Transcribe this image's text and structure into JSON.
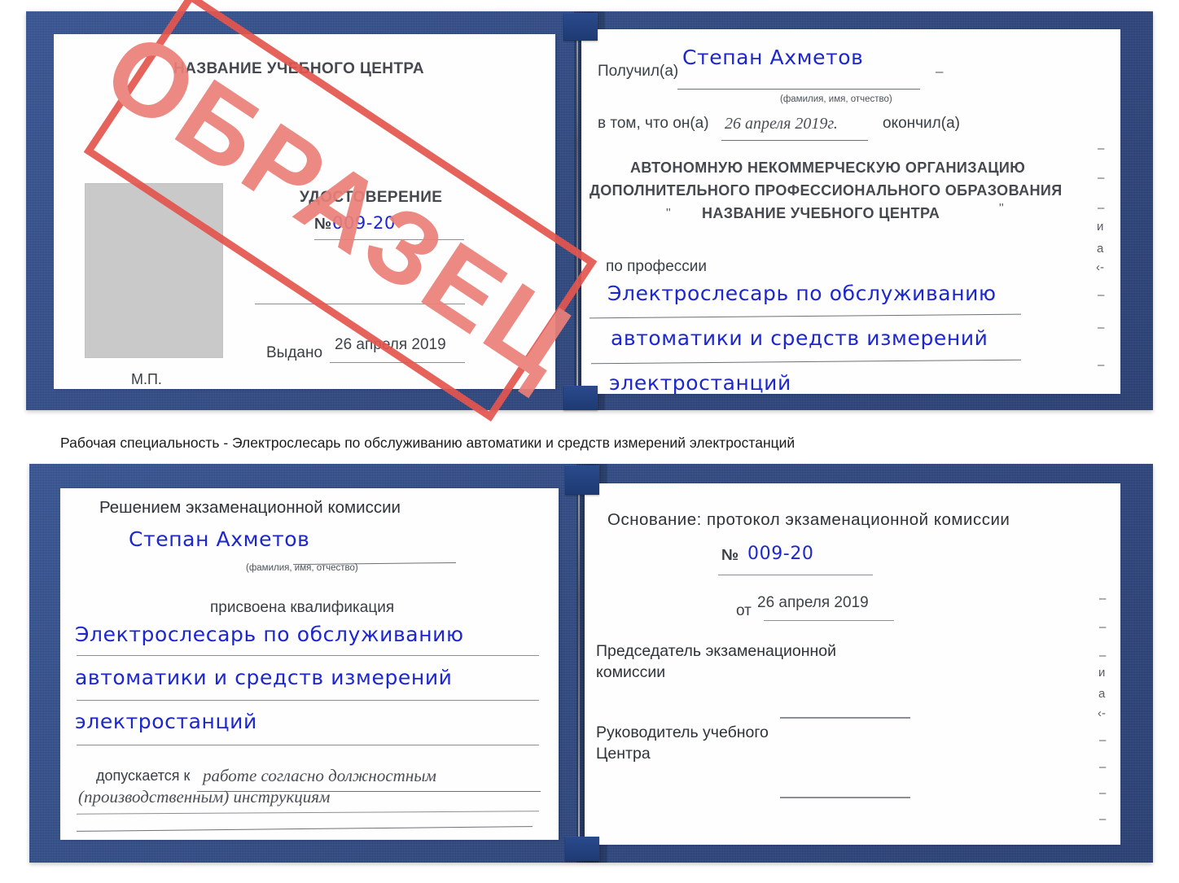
{
  "document": {
    "kind": "udostoverenie-certificate-sample",
    "stamp_label": "ОБРАЗЕЦ",
    "accent_red": "#e4564f",
    "cover_blue": "#24407e",
    "ink_blue": "#1d27cf"
  },
  "caption": {
    "text": "Рабочая специальность - Электрослесарь по обслуживанию автоматики и средств измерений электростанций"
  },
  "certificate_top": {
    "left_page": {
      "center_name": "НАЗВАНИЕ УЧЕБНОГО ЦЕНТРА",
      "doc_title": "УДОСТОВЕРЕНИЕ",
      "number_label": "№",
      "number_value": "009-20",
      "issued_label": "Выдано",
      "issued_value": "26 апреля 2019",
      "seal_label": "М.П."
    },
    "right_page": {
      "received_label": "Получил(а)",
      "received_value": "Степан Ахметов",
      "fio_hint": "(фамилия, имя, отчество)",
      "that_he_label": "в том, что он(а)",
      "completion_date": "26 апреля 2019г.",
      "finished_label": "окончил(а)",
      "org_line_1": "АВТОНОМНУЮ НЕКОММЕРЧЕСКУЮ ОРГАНИЗАЦИЮ",
      "org_line_2": "ДОПОЛНИТЕЛЬНОГО ПРОФЕССИОНАЛЬНОГО ОБРАЗОВАНИЯ",
      "org_quote_open": "\"",
      "org_line_3": "НАЗВАНИЕ УЧЕБНОГО ЦЕНТРА",
      "org_quote_close": "\"",
      "profession_label": "по профессии",
      "profession_line_1": "Электрослесарь по обслуживанию",
      "profession_line_2": "автоматики и средств измерений",
      "profession_line_3": "электростанций",
      "margin_marks": [
        "–",
        "–",
        "–",
        "и",
        "а",
        "‹-",
        "–",
        "–",
        "–"
      ]
    }
  },
  "certificate_bottom": {
    "left_page": {
      "decision_label": "Решением экзаменационной комиссии",
      "name_value": "Степан Ахметов",
      "fio_hint": "(фамилия, имя, отчество)",
      "qualification_label": "присвоена квалификация",
      "qualification_line_1": "Электрослесарь по обслуживанию",
      "qualification_line_2": "автоматики и средств измерений",
      "qualification_line_3": "электростанций",
      "admitted_label": "допускается к",
      "admitted_value_1": "работе согласно должностным",
      "admitted_value_2": "(производственным) инструкциям"
    },
    "right_page": {
      "basis_label": "Основание: протокол экзаменационной комиссии",
      "number_label": "№",
      "number_value": "009-20",
      "date_label": "от",
      "date_value": "26 апреля 2019",
      "chairman_line_1": "Председатель экзаменационной",
      "chairman_line_2": "комиссии",
      "head_line_1": "Руководитель учебного",
      "head_line_2": "Центра",
      "margin_marks": [
        "–",
        "–",
        "–",
        "и",
        "а",
        "‹-",
        "–",
        "–",
        "–",
        "–"
      ]
    }
  }
}
